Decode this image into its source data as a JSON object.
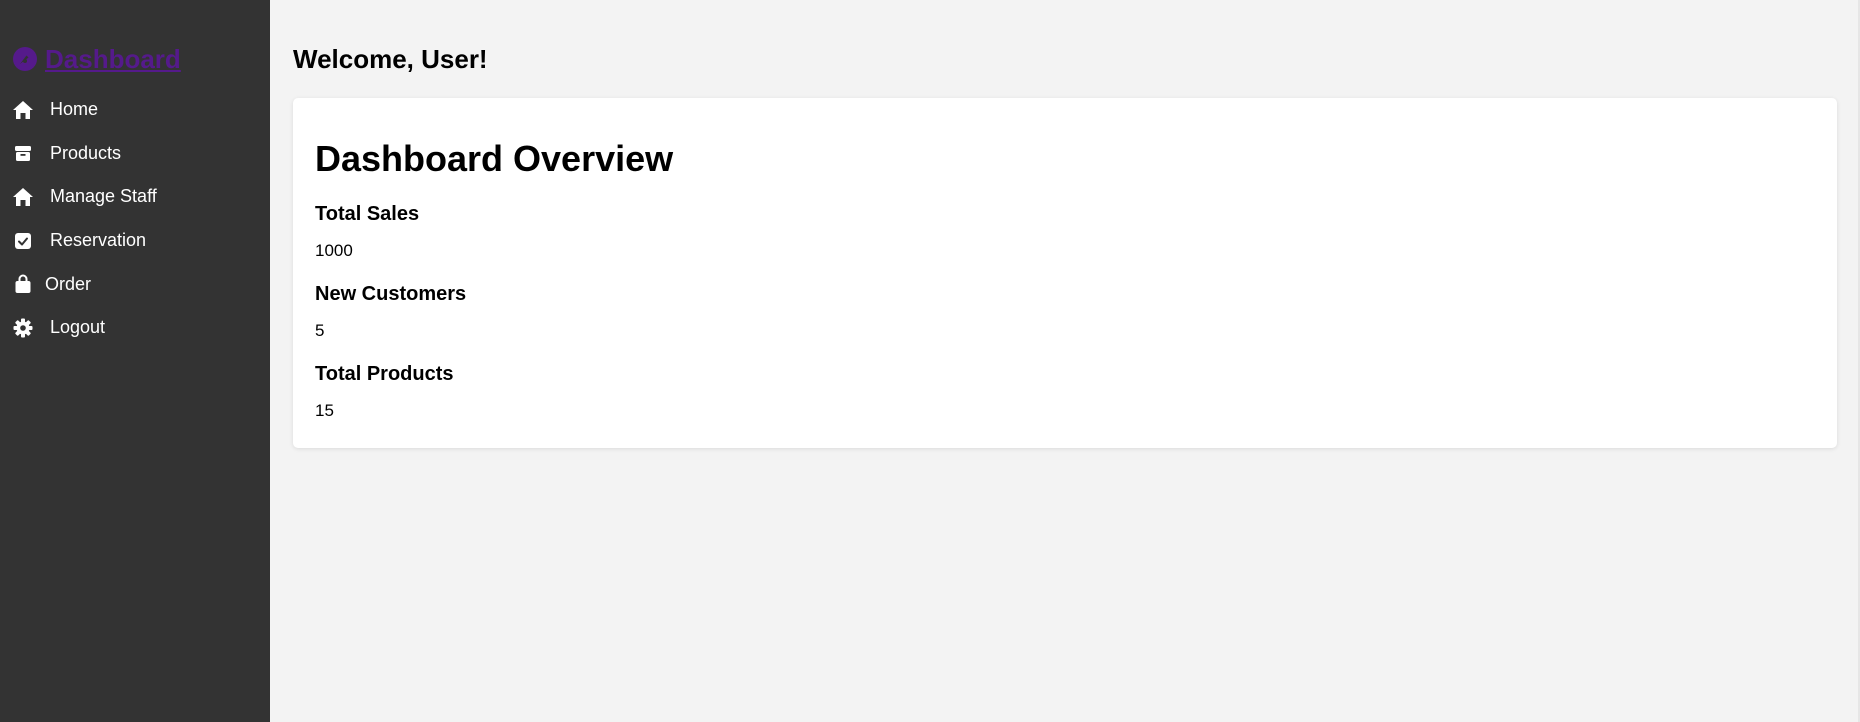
{
  "sidebar": {
    "brand": {
      "label": "Dashboard",
      "icon": "gauge-icon",
      "color": "#551a8b"
    },
    "items": [
      {
        "label": "Home",
        "icon": "home-icon"
      },
      {
        "label": "Products",
        "icon": "box-icon"
      },
      {
        "label": "Manage Staff",
        "icon": "home-icon"
      },
      {
        "label": "Reservation",
        "icon": "check-square-icon"
      },
      {
        "label": "Order",
        "icon": "shopping-bag-icon"
      },
      {
        "label": "Logout",
        "icon": "gear-icon"
      }
    ],
    "background": "#333333"
  },
  "header": {
    "welcome": "Welcome, User!"
  },
  "overview": {
    "title": "Dashboard Overview",
    "stats": [
      {
        "title": "Total Sales",
        "value": "1000"
      },
      {
        "title": "New Customers",
        "value": "5"
      },
      {
        "title": "Total Products",
        "value": "15"
      }
    ]
  }
}
